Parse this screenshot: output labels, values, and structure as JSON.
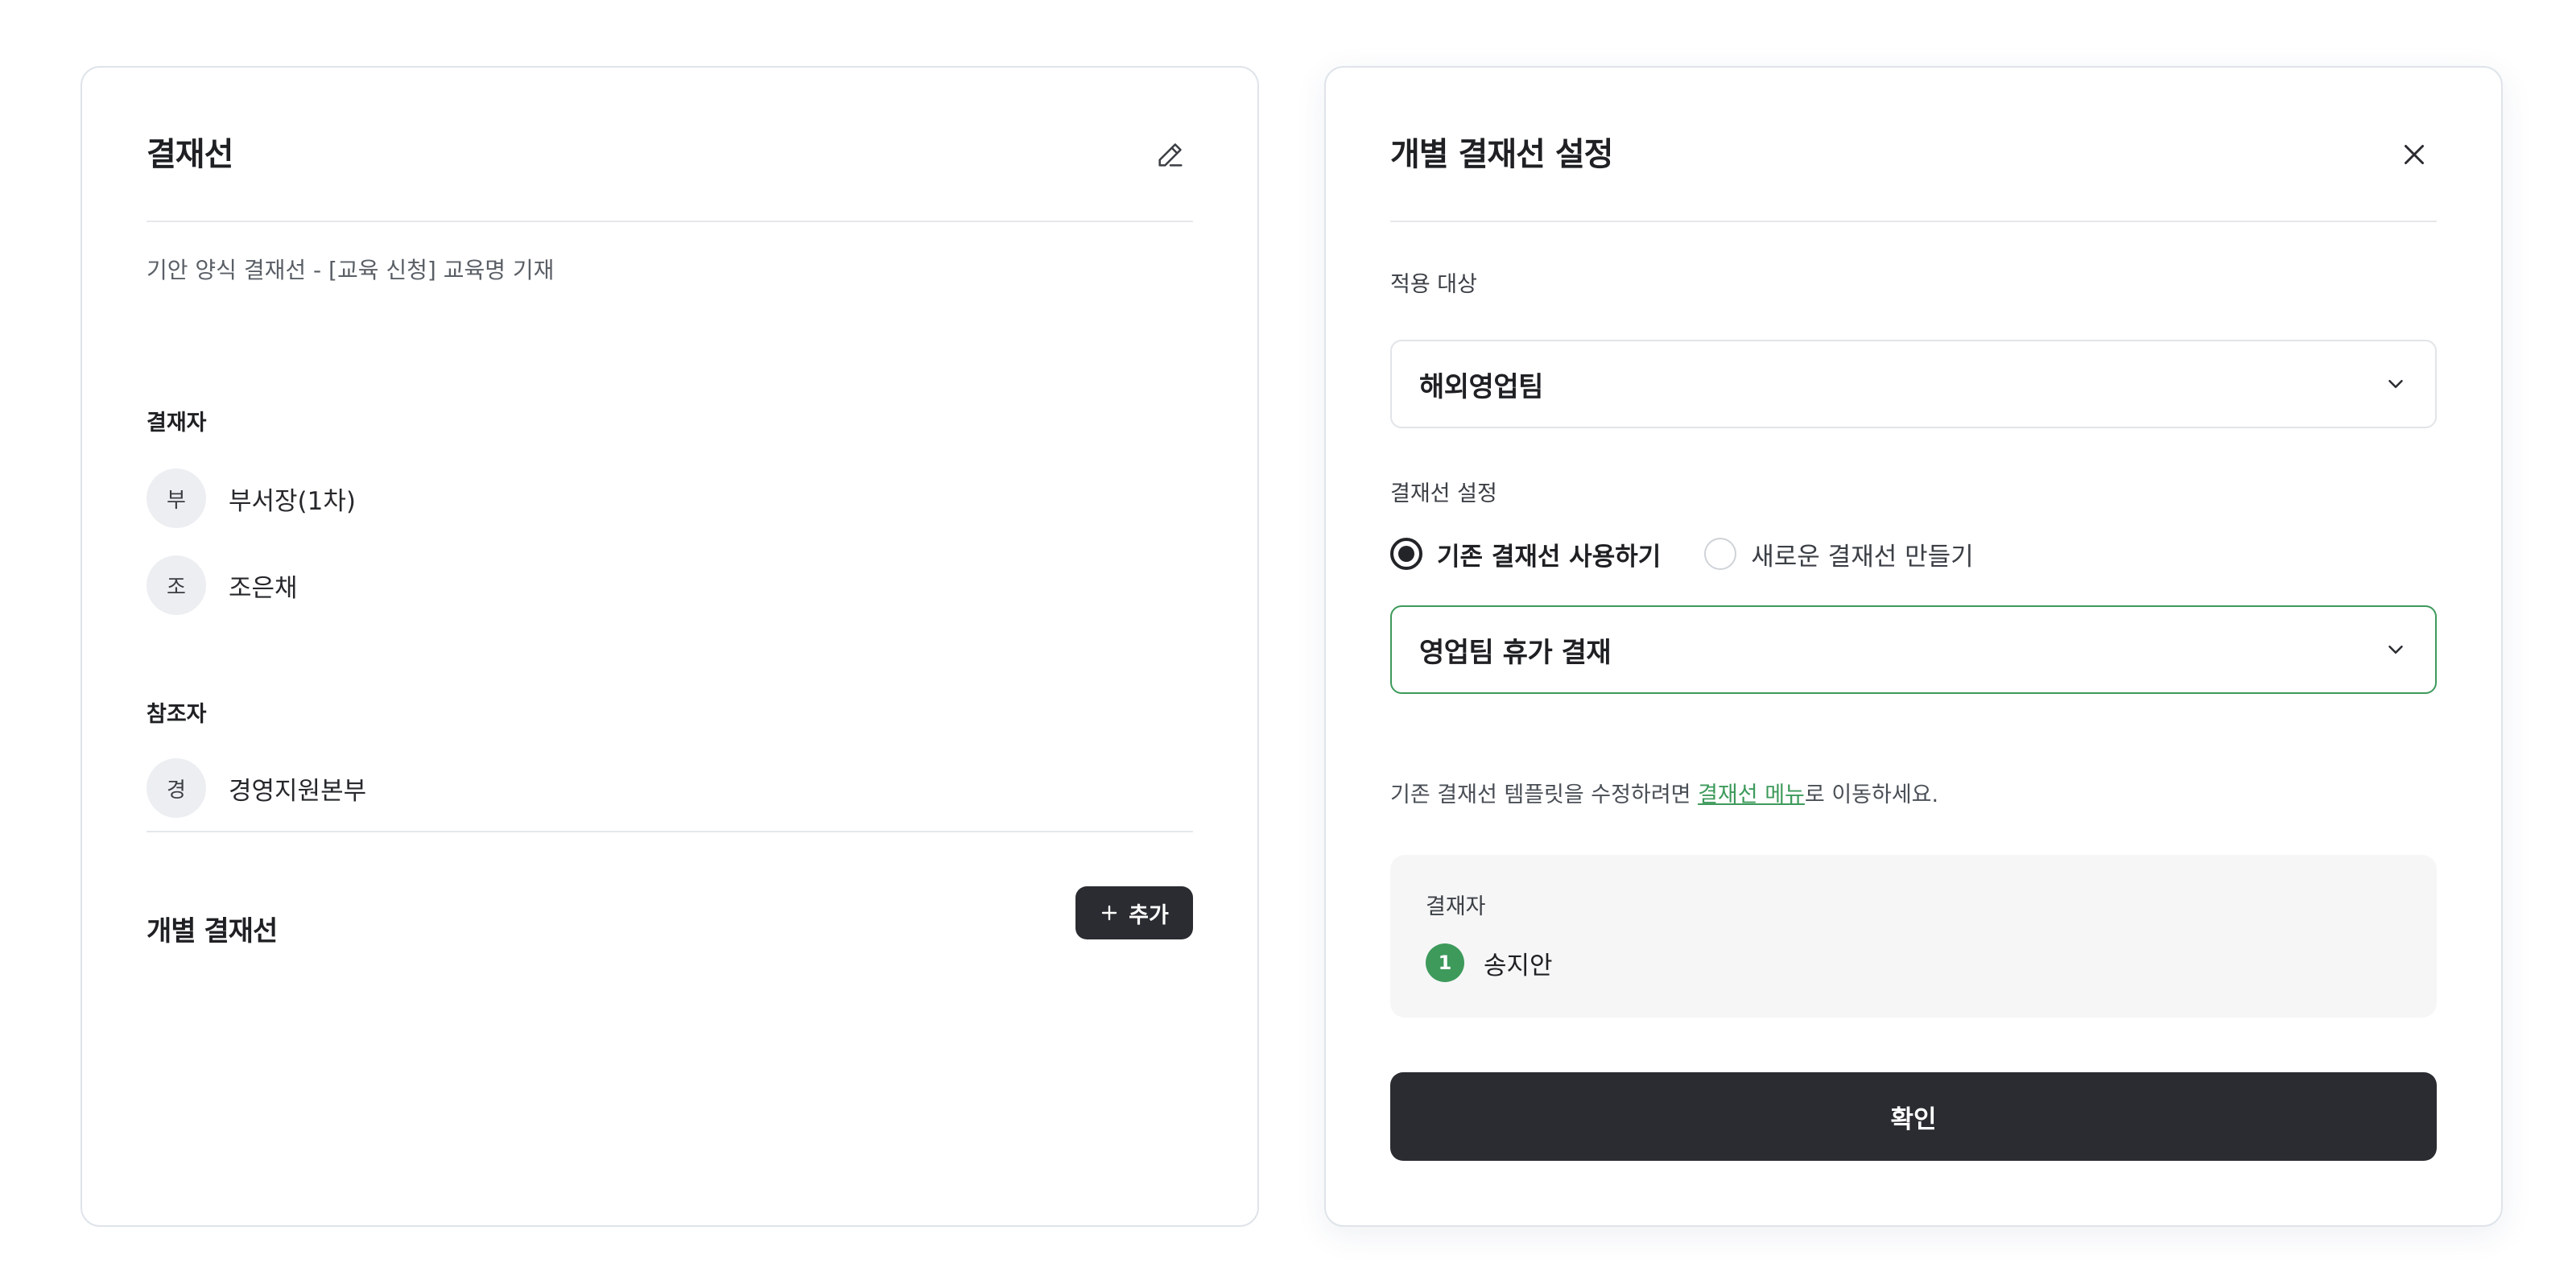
{
  "approval_line": {
    "title": "결재선",
    "edit_icon": "pencil-icon",
    "subtitle": "기안 양식 결재선 - [교육 신청] 교육명 기재",
    "approvers_label": "결재자",
    "approvers": [
      {
        "initial": "부",
        "name": "부서장(1차)"
      },
      {
        "initial": "조",
        "name": "조은채"
      }
    ],
    "references_label": "참조자",
    "references": [
      {
        "initial": "경",
        "name": "경영지원본부"
      }
    ],
    "individual_title": "개별 결재선",
    "add_button": {
      "icon": "plus-icon",
      "label": "추가"
    }
  },
  "settings": {
    "title": "개별 결재선 설정",
    "close_icon": "close-icon",
    "target_label": "적용 대상",
    "target_value": "해외영업팀",
    "line_setting_label": "결재선 설정",
    "radio_options": [
      {
        "label": "기존 결재선 사용하기",
        "checked": true
      },
      {
        "label": "새로운 결재선 만들기",
        "checked": false
      }
    ],
    "line_select_value": "영업팀 휴가 결재",
    "help_before": "기존 결재선 템플릿을 수정하려면 ",
    "help_link": "결재선 메뉴",
    "help_after": "로 이동하세요.",
    "approvers_box_label": "결재자",
    "approver": {
      "step": "1",
      "name": "송지안"
    },
    "confirm_label": "확인"
  },
  "colors": {
    "accent_green": "#3d9a5b",
    "dark_button": "#2a2c31",
    "border": "#dfe4ea"
  }
}
